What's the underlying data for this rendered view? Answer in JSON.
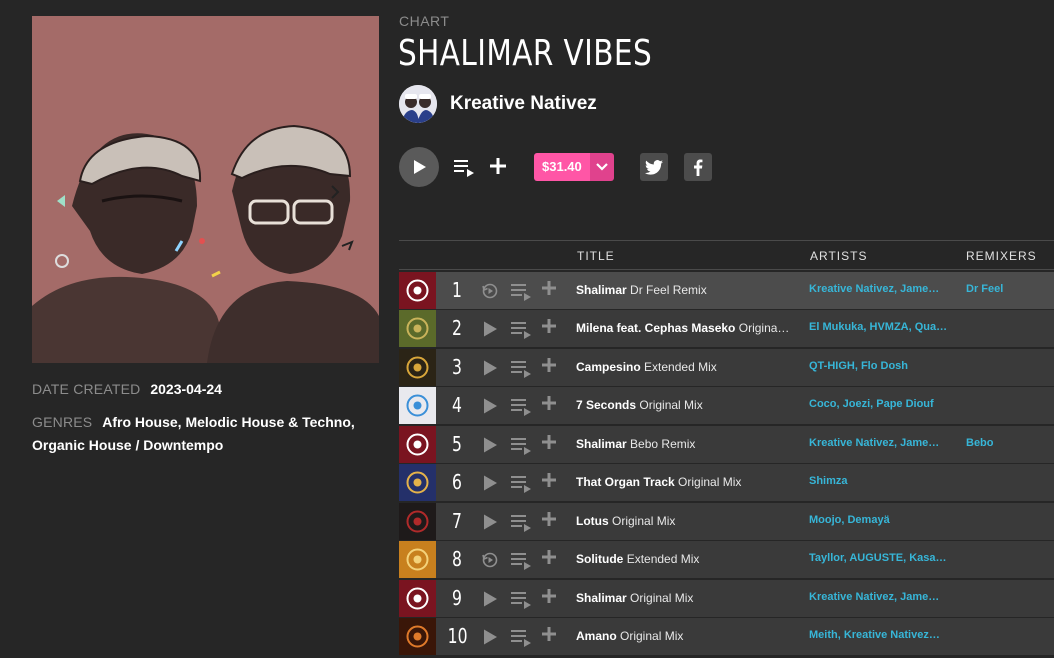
{
  "chart": {
    "label": "CHART",
    "title": "SHALIMAR VIBES",
    "artist": "Kreative Nativez",
    "price": "$31.40"
  },
  "meta": {
    "date_label": "DATE CREATED",
    "date_value": "2023-04-24",
    "genres_label": "GENRES",
    "genres_value": "Afro House, Melodic House & Techno, Organic House / Downtempo"
  },
  "table": {
    "headers": {
      "title": "TITLE",
      "artists": "ARTISTS",
      "remixers": "REMIXERS"
    },
    "rows": [
      {
        "num": "1",
        "name": "Shalimar",
        "mix": "Dr Feel Remix",
        "artists": "Kreative Nativez, Jame…",
        "remixers": "Dr Feel"
      },
      {
        "num": "2",
        "name": "Milena feat. Cephas Maseko",
        "mix": "Origina…",
        "artists": "El Mukuka, HVMZA, Qua…",
        "remixers": ""
      },
      {
        "num": "3",
        "name": "Campesino",
        "mix": "Extended Mix",
        "artists": "QT-HIGH, Flo Dosh",
        "remixers": ""
      },
      {
        "num": "4",
        "name": "7 Seconds",
        "mix": "Original Mix",
        "artists": "Coco, Joezi, Pape Diouf",
        "remixers": ""
      },
      {
        "num": "5",
        "name": "Shalimar",
        "mix": "Bebo Remix",
        "artists": "Kreative Nativez, Jame…",
        "remixers": "Bebo"
      },
      {
        "num": "6",
        "name": "That Organ Track",
        "mix": "Original Mix",
        "artists": "Shimza",
        "remixers": ""
      },
      {
        "num": "7",
        "name": "Lotus",
        "mix": "Original Mix",
        "artists": "Moojo, Demayä",
        "remixers": ""
      },
      {
        "num": "8",
        "name": "Solitude",
        "mix": "Extended Mix",
        "artists": "Tayllor, AUGUSTE, Kasa…",
        "remixers": ""
      },
      {
        "num": "9",
        "name": "Shalimar",
        "mix": "Original Mix",
        "artists": "Kreative Nativez, Jame…",
        "remixers": ""
      },
      {
        "num": "10",
        "name": "Amano",
        "mix": "Original Mix",
        "artists": "Meith, Kreative Nativez…",
        "remixers": ""
      }
    ]
  },
  "icons": {
    "play": "play-icon",
    "queue": "add-to-queue-icon",
    "add": "plus-icon",
    "twitter": "twitter-icon",
    "facebook": "facebook-icon",
    "replay": "replay-icon"
  },
  "colors": {
    "background": "#262626",
    "row": "#3a3a3a",
    "row_active": "#4c4c4c",
    "price": "#ff56a6",
    "link": "#37b6d8",
    "artwork": "#a46b68"
  }
}
